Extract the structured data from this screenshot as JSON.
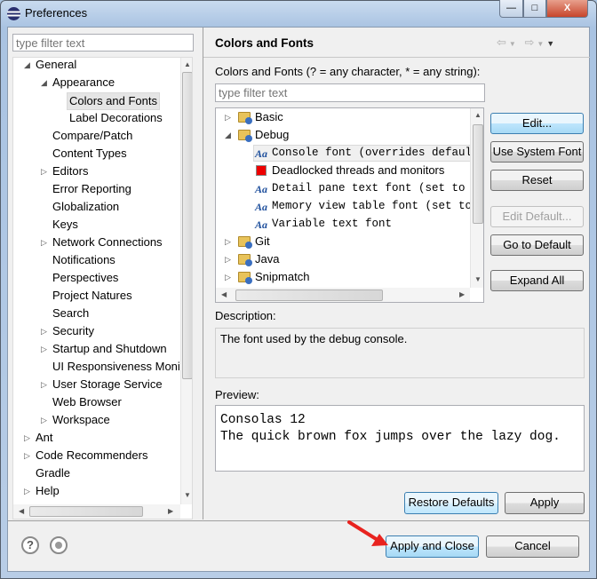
{
  "window": {
    "title": "Preferences",
    "minimize": "—",
    "maximize": "□",
    "close": "X"
  },
  "sidebar": {
    "filter_placeholder": "type filter text",
    "items": [
      {
        "label": "General",
        "level": 0,
        "expander": "expanded"
      },
      {
        "label": "Appearance",
        "level": 1,
        "expander": "expanded"
      },
      {
        "label": "Colors and Fonts",
        "level": 2,
        "expander": "none",
        "selected": true
      },
      {
        "label": "Label Decorations",
        "level": 2,
        "expander": "none"
      },
      {
        "label": "Compare/Patch",
        "level": 1,
        "expander": "none"
      },
      {
        "label": "Content Types",
        "level": 1,
        "expander": "none"
      },
      {
        "label": "Editors",
        "level": 1,
        "expander": "collapsed"
      },
      {
        "label": "Error Reporting",
        "level": 1,
        "expander": "none"
      },
      {
        "label": "Globalization",
        "level": 1,
        "expander": "none"
      },
      {
        "label": "Keys",
        "level": 1,
        "expander": "none"
      },
      {
        "label": "Network Connections",
        "level": 1,
        "expander": "collapsed"
      },
      {
        "label": "Notifications",
        "level": 1,
        "expander": "none"
      },
      {
        "label": "Perspectives",
        "level": 1,
        "expander": "none"
      },
      {
        "label": "Project Natures",
        "level": 1,
        "expander": "none"
      },
      {
        "label": "Search",
        "level": 1,
        "expander": "none"
      },
      {
        "label": "Security",
        "level": 1,
        "expander": "collapsed"
      },
      {
        "label": "Startup and Shutdown",
        "level": 1,
        "expander": "collapsed"
      },
      {
        "label": "UI Responsiveness Moni",
        "level": 1,
        "expander": "none"
      },
      {
        "label": "User Storage Service",
        "level": 1,
        "expander": "collapsed"
      },
      {
        "label": "Web Browser",
        "level": 1,
        "expander": "none"
      },
      {
        "label": "Workspace",
        "level": 1,
        "expander": "collapsed"
      },
      {
        "label": "Ant",
        "level": 0,
        "expander": "collapsed"
      },
      {
        "label": "Code Recommenders",
        "level": 0,
        "expander": "collapsed"
      },
      {
        "label": "Gradle",
        "level": 0,
        "expander": "none"
      },
      {
        "label": "Help",
        "level": 0,
        "expander": "collapsed"
      }
    ]
  },
  "page": {
    "title": "Colors and Fonts",
    "filter_label": "Colors and Fonts (? = any character, * = any string):",
    "filter_placeholder": "type filter text",
    "tree": [
      {
        "label": "Basic",
        "type": "category",
        "expander": "collapsed"
      },
      {
        "label": "Debug",
        "type": "category",
        "expander": "expanded"
      },
      {
        "label": "Console font (overrides default:",
        "type": "font",
        "selected": true
      },
      {
        "label": "Deadlocked threads and monitors",
        "type": "color",
        "color": "#ee0000"
      },
      {
        "label": "Detail pane text font (set to de",
        "type": "font"
      },
      {
        "label": "Memory view table font (set to d",
        "type": "font"
      },
      {
        "label": "Variable text font",
        "type": "font"
      },
      {
        "label": "Git",
        "type": "category",
        "expander": "collapsed"
      },
      {
        "label": "Java",
        "type": "category",
        "expander": "collapsed"
      },
      {
        "label": "Snipmatch",
        "type": "category",
        "expander": "collapsed"
      }
    ],
    "buttons": {
      "edit": "Edit...",
      "use_system_font": "Use System Font",
      "reset": "Reset",
      "edit_default": "Edit Default...",
      "go_to_default": "Go to Default",
      "expand_all": "Expand All"
    },
    "description_label": "Description:",
    "description": "The font used by the debug console.",
    "preview_label": "Preview:",
    "preview_line1": "Consolas 12",
    "preview_line2": "The quick brown fox jumps over the lazy dog.",
    "restore_defaults": "Restore Defaults",
    "apply": "Apply"
  },
  "footer": {
    "apply_and_close": "Apply and Close",
    "cancel": "Cancel",
    "help_icon": "?"
  },
  "colors": {
    "annotation_arrow": "#e8231f",
    "default_button": "#bee6fd"
  }
}
